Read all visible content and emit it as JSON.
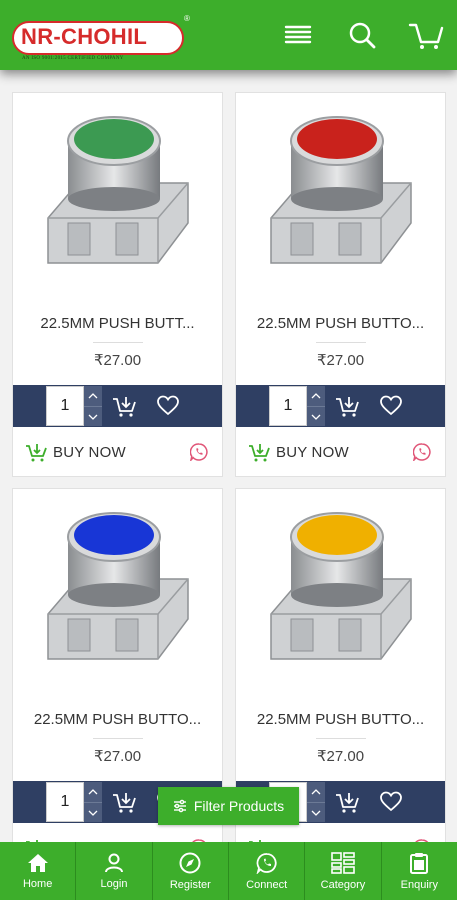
{
  "header": {
    "logo_text": "NR-CHOHIL",
    "logo_tagline": "AN ISO 9001:2015 CERTIFIED COMPANY",
    "logo_reg": "®",
    "icons": [
      "menu-icon",
      "search-icon",
      "cart-icon"
    ]
  },
  "products": [
    {
      "name": "22.5MM PUSH BUTT...",
      "price": "₹27.00",
      "qty": "1",
      "button_color": "#3c9a52",
      "buy_label": "BUY NOW"
    },
    {
      "name": "22.5MM PUSH BUTTO...",
      "price": "₹27.00",
      "qty": "1",
      "button_color": "#c9221c",
      "buy_label": "BUY NOW"
    },
    {
      "name": "22.5MM PUSH BUTTO...",
      "price": "₹27.00",
      "qty": "1",
      "button_color": "#1836d6",
      "buy_label": "BUY NOW"
    },
    {
      "name": "22.5MM PUSH BUTTO...",
      "price": "₹27.00",
      "qty": "1",
      "button_color": "#f0b000",
      "buy_label": "BUY NOW"
    }
  ],
  "filter_label": "Filter Products",
  "bottom_nav": [
    {
      "label": "Home",
      "icon": "home-icon"
    },
    {
      "label": "Login",
      "icon": "user-icon"
    },
    {
      "label": "Register",
      "icon": "compass-icon"
    },
    {
      "label": "Connect",
      "icon": "whatsapp-icon"
    },
    {
      "label": "Category",
      "icon": "category-icon"
    },
    {
      "label": "Enquiry",
      "icon": "clipboard-icon"
    }
  ],
  "colors": {
    "brand_green": "#3dae2b",
    "cart_bar": "#2f3f63",
    "logo_red": "#d62b2b"
  }
}
